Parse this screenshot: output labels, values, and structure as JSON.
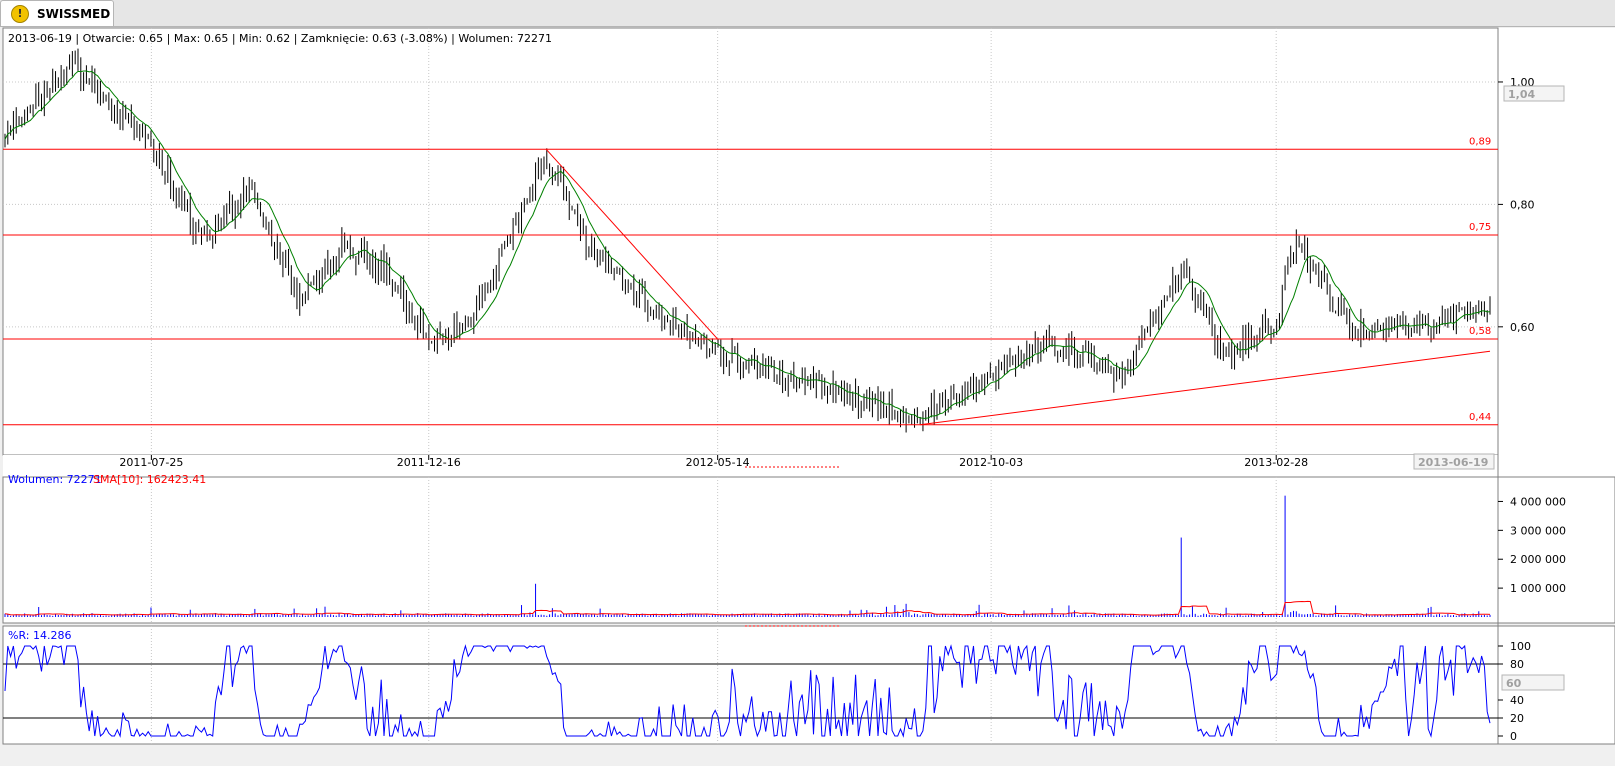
{
  "tab": {
    "title": "SWISSMED",
    "icon": "warning-icon"
  },
  "header": {
    "info": "2013-06-19 | Otwarcie: 0.65 | Max: 0.65 | Min: 0.62 | Zamknięcie: 0.63 (-3.08%)  | Wolumen: 72271"
  },
  "price_axis": {
    "ticks": [
      "1,00",
      "0,80",
      "0,60"
    ],
    "current_label": "1,04"
  },
  "levels": [
    {
      "label": "0,89",
      "value": 0.89
    },
    {
      "label": "0,75",
      "value": 0.75
    },
    {
      "label": "0,58",
      "value": 0.58
    },
    {
      "label": "0,44",
      "value": 0.44
    }
  ],
  "date_axis": {
    "ticks": [
      "2011-07-25",
      "2011-12-16",
      "2012-05-14",
      "2012-10-03",
      "2013-02-28"
    ],
    "current_date": "2013-06-19"
  },
  "volume_panel": {
    "label_volume": "Wolumen: 72271",
    "label_sma": "SMA[10]: 162423.41",
    "ticks": [
      "4 000 000",
      "3 000 000",
      "2 000 000",
      "1 000 000"
    ]
  },
  "wr_panel": {
    "label": "%R: 14.286",
    "ticks": [
      "100",
      "80",
      "40",
      "20",
      "0"
    ],
    "current_label": "60"
  },
  "colors": {
    "price": "#000000",
    "sma": "#008000",
    "level": "#ff0000",
    "volume": "#0000ff",
    "volume_sma": "#ff0000",
    "wr": "#0000ff"
  },
  "chart_data": [
    {
      "type": "bar",
      "subtype": "ohlc",
      "title": "SWISSMED",
      "overlay": "SMA (green)",
      "ylim": [
        0.42,
        1.08
      ],
      "x_ticks": [
        "2011-07-25",
        "2011-12-16",
        "2012-05-14",
        "2012-10-03",
        "2013-02-28"
      ],
      "trend_anchors": [
        {
          "date": "2011-05-10",
          "close": 0.92
        },
        {
          "date": "2011-06-15",
          "close": 1.03
        },
        {
          "date": "2011-07-25",
          "close": 0.89
        },
        {
          "date": "2011-08-20",
          "close": 0.74
        },
        {
          "date": "2011-09-15",
          "close": 0.83
        },
        {
          "date": "2011-10-10",
          "close": 0.64
        },
        {
          "date": "2011-11-01",
          "close": 0.73
        },
        {
          "date": "2011-11-25",
          "close": 0.69
        },
        {
          "date": "2011-12-16",
          "close": 0.57
        },
        {
          "date": "2012-01-10",
          "close": 0.62
        },
        {
          "date": "2012-02-15",
          "close": 0.88
        },
        {
          "date": "2012-03-10",
          "close": 0.72
        },
        {
          "date": "2012-04-10",
          "close": 0.63
        },
        {
          "date": "2012-05-14",
          "close": 0.56
        },
        {
          "date": "2012-06-15",
          "close": 0.52
        },
        {
          "date": "2012-07-20",
          "close": 0.49
        },
        {
          "date": "2012-08-27",
          "close": 0.45
        },
        {
          "date": "2012-10-03",
          "close": 0.52
        },
        {
          "date": "2012-11-01",
          "close": 0.58
        },
        {
          "date": "2012-12-10",
          "close": 0.52
        },
        {
          "date": "2013-01-10",
          "close": 0.7
        },
        {
          "date": "2013-02-01",
          "close": 0.55
        },
        {
          "date": "2013-02-28",
          "close": 0.61
        },
        {
          "date": "2013-03-10",
          "close": 0.74
        },
        {
          "date": "2013-04-10",
          "close": 0.59
        },
        {
          "date": "2013-05-10",
          "close": 0.6
        },
        {
          "date": "2013-06-19",
          "close": 0.63
        }
      ],
      "last_bar": {
        "date": "2013-06-19",
        "open": 0.65,
        "high": 0.65,
        "low": 0.62,
        "close": 0.63,
        "change_pct": -3.08
      },
      "horizontal_levels": [
        0.89,
        0.75,
        0.58,
        0.44
      ],
      "trendlines": [
        {
          "from": {
            "date": "2012-02-15",
            "value": 0.89
          },
          "to": {
            "date": "2012-05-14",
            "value": 0.58
          }
        },
        {
          "from": {
            "date": "2012-08-27",
            "value": 0.44
          },
          "to": {
            "date": "2013-06-19",
            "value": 0.56
          }
        }
      ]
    },
    {
      "type": "bar",
      "title": "Wolumen",
      "ylim": [
        0,
        4500000
      ],
      "series": [
        {
          "name": "Wolumen",
          "last": 72271
        },
        {
          "name": "SMA[10]",
          "last": 162423.41
        }
      ],
      "spikes": [
        {
          "date": "2012-02-10",
          "value": 1150000
        },
        {
          "date": "2013-01-10",
          "value": 2750000
        },
        {
          "date": "2013-03-05",
          "value": 4200000
        }
      ]
    },
    {
      "type": "line",
      "title": "%R",
      "ylim": [
        0,
        100
      ],
      "series": [
        {
          "name": "%R",
          "last": 14.286
        }
      ],
      "reference_lines": [
        80,
        20
      ]
    }
  ]
}
